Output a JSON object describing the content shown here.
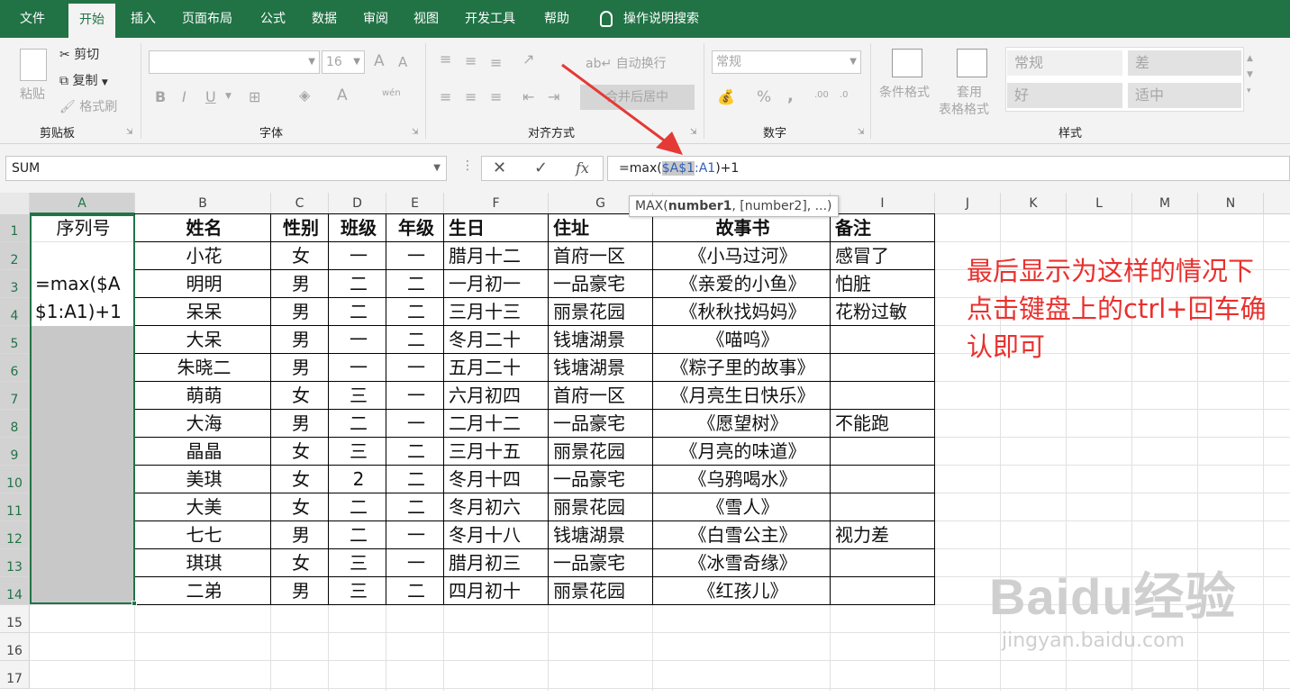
{
  "tabs": [
    "文件",
    "开始",
    "插入",
    "页面布局",
    "公式",
    "数据",
    "审阅",
    "视图",
    "开发工具",
    "帮助"
  ],
  "active_tab": "开始",
  "help_search": "操作说明搜索",
  "clipboard": {
    "paste": "粘贴",
    "cut": "剪切",
    "copy": "复制",
    "format_painter": "格式刷",
    "label": "剪贴板"
  },
  "font": {
    "size": "16",
    "label": "字体",
    "bold": "B",
    "italic": "I",
    "underline": "U",
    "grow": "A",
    "shrink": "A",
    "font_color": "A",
    "phonetic": "wén"
  },
  "alignment": {
    "wrap_text": "自动换行",
    "merge_center": "合并后居中",
    "label": "对齐方式"
  },
  "number": {
    "format": "常规",
    "percent": "%",
    "comma": ",",
    "label": "数字"
  },
  "styles": {
    "conditional": "条件格式",
    "table_format_1": "套用",
    "table_format_2": "表格格式",
    "normal": "常规",
    "bad": "差",
    "good": "好",
    "neutral": "适中",
    "label": "样式"
  },
  "name_box": "SUM",
  "formula": {
    "prefix": "=max(",
    "ref_selected": "$A$1",
    "colon": ":",
    "ref_end": "A1",
    "suffix": ")+1"
  },
  "fx_cancel": "✕",
  "fx_enter": "✓",
  "fx_label": "fx",
  "tooltip": {
    "fn": "MAX(",
    "arg1": "number1",
    "rest": ", [number2], ...)"
  },
  "columns": [
    "A",
    "B",
    "C",
    "D",
    "E",
    "F",
    "G",
    "H",
    "I",
    "J",
    "K",
    "L",
    "M",
    "N"
  ],
  "rows": [
    "1",
    "2",
    "3",
    "4",
    "5",
    "6",
    "7",
    "8",
    "9",
    "10",
    "11",
    "12",
    "13",
    "14",
    "15",
    "16",
    "17"
  ],
  "edit_text_1": "=max($A",
  "edit_text_2": "$1:A1)+1",
  "header_a": "序列号",
  "headers": [
    "姓名",
    "性别",
    "班级",
    "年级",
    "生日",
    "住址",
    "故事书",
    "备注"
  ],
  "records": [
    [
      "小花",
      "女",
      "一",
      "一",
      "腊月十二",
      "首府一区",
      "《小马过河》",
      "感冒了"
    ],
    [
      "明明",
      "男",
      "二",
      "二",
      "一月初一",
      "一品豪宅",
      "《亲爱的小鱼》",
      "怕脏"
    ],
    [
      "呆呆",
      "男",
      "二",
      "二",
      "三月十三",
      "丽景花园",
      "《秋秋找妈妈》",
      "花粉过敏"
    ],
    [
      "大呆",
      "男",
      "一",
      "二",
      "冬月二十",
      "钱塘湖景",
      "《喵呜》",
      ""
    ],
    [
      "朱晓二",
      "男",
      "一",
      "一",
      "五月二十",
      "钱塘湖景",
      "《粽子里的故事》",
      ""
    ],
    [
      "萌萌",
      "女",
      "三",
      "一",
      "六月初四",
      "首府一区",
      "《月亮生日快乐》",
      ""
    ],
    [
      "大海",
      "男",
      "二",
      "一",
      "二月十二",
      "一品豪宅",
      "《愿望树》",
      "不能跑"
    ],
    [
      "晶晶",
      "女",
      "三",
      "二",
      "三月十五",
      "丽景花园",
      "《月亮的味道》",
      ""
    ],
    [
      "美琪",
      "女",
      "2",
      "二",
      "冬月十四",
      "一品豪宅",
      "《乌鸦喝水》",
      ""
    ],
    [
      "大美",
      "女",
      "二",
      "二",
      "冬月初六",
      "丽景花园",
      "《雪人》",
      ""
    ],
    [
      "七七",
      "男",
      "二",
      "一",
      "冬月十八",
      "钱塘湖景",
      "《白雪公主》",
      "视力差"
    ],
    [
      "琪琪",
      "女",
      "三",
      "一",
      "腊月初三",
      "一品豪宅",
      "《冰雪奇缘》",
      ""
    ],
    [
      "二弟",
      "男",
      "三",
      "二",
      "四月初十",
      "丽景花园",
      "《红孩儿》",
      ""
    ]
  ],
  "annotation": "最后显示为这样的情况下 点击键盘上的ctrl+回车确认即可",
  "watermark_big": "Baidu经验",
  "watermark_small": "jingyan.baidu.com",
  "colors": {
    "excel_green": "#217346",
    "annotation_red": "#e8312e",
    "arrow_red": "#e53935"
  }
}
